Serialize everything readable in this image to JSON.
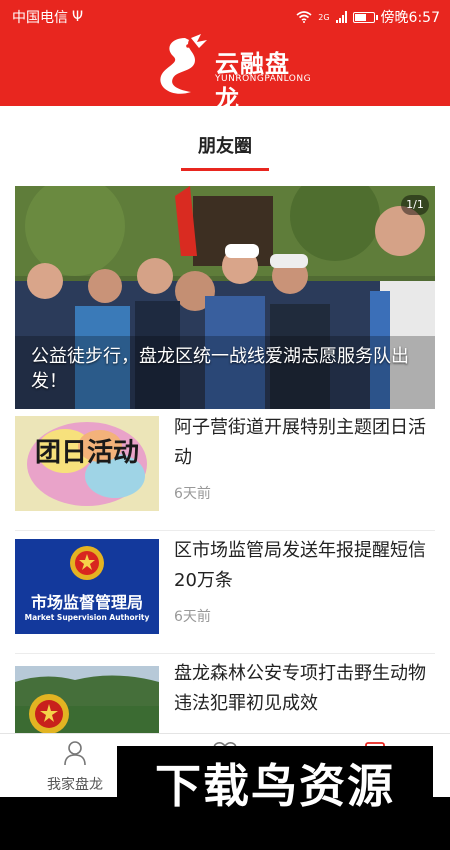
{
  "status_bar": {
    "carrier": "中国电信",
    "usb_symbol": "Ψ",
    "network_type": "2G",
    "time": "傍晚6:57",
    "battery_level": 0.65
  },
  "brand": {
    "name": "云融盘龙",
    "subtitle": "YUNRONGPANLONG"
  },
  "section_tab": {
    "label": "朋友圈"
  },
  "hero": {
    "caption": "公益徒步行，盘龙区统一战线爱湖志愿服务队出发！",
    "counter": "1/1"
  },
  "news": [
    {
      "title": "阿子营街道开展特别主题团日活动",
      "time": "6天前",
      "thumb_text": "团日活动"
    },
    {
      "title": "区市场监管局发送年报提醒短信20万条",
      "time": "6天前",
      "thumb_text_cn": "市场监督管理局",
      "thumb_text_en": "Market Supervision Authority"
    },
    {
      "title": "盘龙森林公安专项打击野生动物违法犯罪初见成效",
      "time": ""
    }
  ],
  "bottom_nav": [
    {
      "label": "我家盘龙",
      "icon": "person-icon"
    },
    {
      "label": "",
      "icon": "heart-icon"
    },
    {
      "label": "",
      "icon": "square-icon"
    }
  ],
  "watermark": {
    "text": "下载鸟资源"
  },
  "colors": {
    "brand_red": "#e8261f",
    "text_dark": "#222222",
    "text_muted": "#999999"
  }
}
